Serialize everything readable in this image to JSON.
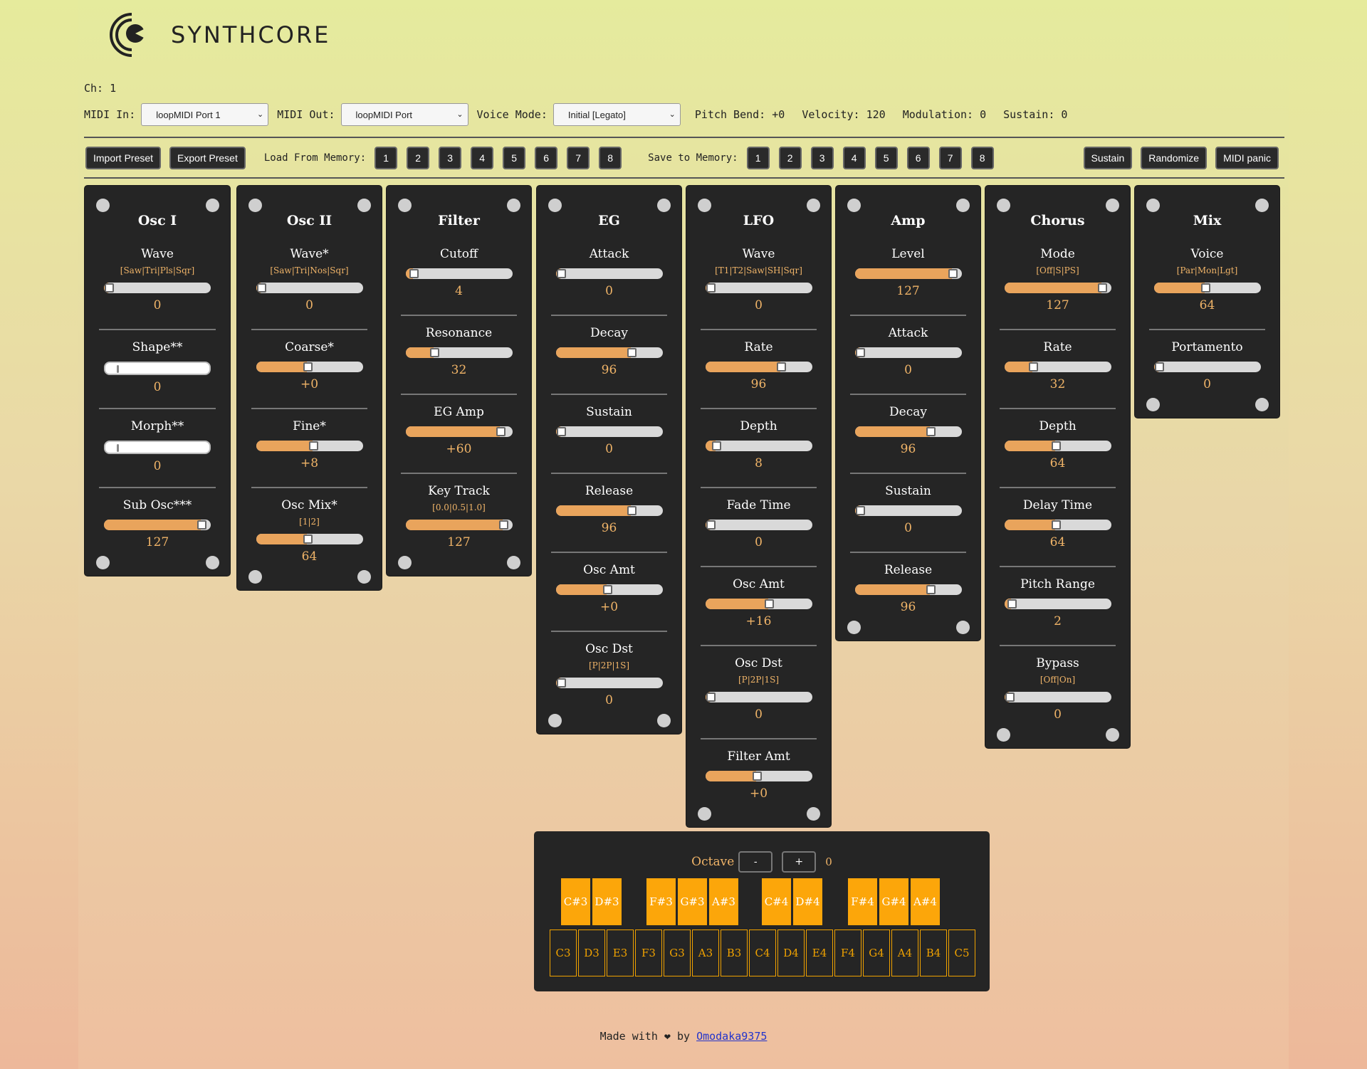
{
  "app": {
    "logo_text": "SYNTHCORE",
    "channel": "Ch: 1"
  },
  "midi": {
    "in_label": "MIDI In:",
    "in_value": "loopMIDI Port 1",
    "out_label": "MIDI Out:",
    "out_value": "loopMIDI Port",
    "voice_label": "Voice Mode:",
    "voice_value": "Initial [Legato]",
    "pitch_bend": "Pitch Bend: +0",
    "velocity": "Velocity: 120",
    "modulation": "Modulation: 0",
    "sustain": "Sustain: 0"
  },
  "toolbar": {
    "import": "Import Preset",
    "export": "Export Preset",
    "load_label": "Load From Memory:",
    "save_label": "Save to Memory:",
    "slots": [
      "1",
      "2",
      "3",
      "4",
      "5",
      "6",
      "7",
      "8"
    ],
    "sustain": "Sustain",
    "randomize": "Randomize",
    "panic": "MIDI panic"
  },
  "panels": [
    {
      "title": "Osc I",
      "params": [
        {
          "name": "Wave",
          "opts": "[Saw|Tri|Pls|Sqr]",
          "value": "0",
          "level": 0
        },
        {
          "name": "Shape**",
          "opts": "",
          "value": "0",
          "level": 0,
          "style": "white"
        },
        {
          "name": "Morph**",
          "opts": "",
          "value": "0",
          "level": 0,
          "style": "white"
        },
        {
          "name": "Sub Osc***",
          "opts": "",
          "value": "127",
          "level": 1
        }
      ]
    },
    {
      "title": "Osc II",
      "params": [
        {
          "name": "Wave*",
          "opts": "[Saw|Tri|Nos|Sqr]",
          "value": "0",
          "level": 0
        },
        {
          "name": "Coarse*",
          "opts": "",
          "value": "+0",
          "level": 0.5
        },
        {
          "name": "Fine*",
          "opts": "",
          "value": "+8",
          "level": 0.56
        },
        {
          "name": "Osc Mix*",
          "opts": "[1|2]",
          "value": "64",
          "level": 0.5
        }
      ]
    },
    {
      "title": "Filter",
      "params": [
        {
          "name": "Cutoff",
          "opts": "",
          "value": "4",
          "level": 0.03
        },
        {
          "name": "Resonance",
          "opts": "",
          "value": "32",
          "level": 0.25
        },
        {
          "name": "EG Amp",
          "opts": "",
          "value": "+60",
          "level": 0.97
        },
        {
          "name": "Key Track",
          "opts": "[0.0|0.5|1.0]",
          "value": "127",
          "level": 1
        }
      ]
    },
    {
      "title": "EG",
      "params": [
        {
          "name": "Attack",
          "opts": "",
          "value": "0",
          "level": 0
        },
        {
          "name": "Decay",
          "opts": "",
          "value": "96",
          "level": 0.76
        },
        {
          "name": "Sustain",
          "opts": "",
          "value": "0",
          "level": 0
        },
        {
          "name": "Release",
          "opts": "",
          "value": "96",
          "level": 0.76
        },
        {
          "name": "Osc Amt",
          "opts": "",
          "value": "+0",
          "level": 0.5
        },
        {
          "name": "Osc Dst",
          "opts": "[P|2P|1S]",
          "value": "0",
          "level": 0
        }
      ]
    },
    {
      "title": "LFO",
      "params": [
        {
          "name": "Wave",
          "opts": "[T1|T2|Saw|SH|Sqr]",
          "value": "0",
          "level": 0
        },
        {
          "name": "Rate",
          "opts": "",
          "value": "96",
          "level": 0.76
        },
        {
          "name": "Depth",
          "opts": "",
          "value": "8",
          "level": 0.06
        },
        {
          "name": "Fade Time",
          "opts": "",
          "value": "0",
          "level": 0
        },
        {
          "name": "Osc Amt",
          "opts": "",
          "value": "+16",
          "level": 0.63
        },
        {
          "name": "Osc Dst",
          "opts": "[P|2P|1S]",
          "value": "0",
          "level": 0
        },
        {
          "name": "Filter Amt",
          "opts": "",
          "value": "+0",
          "level": 0.5
        }
      ]
    },
    {
      "title": "Amp",
      "params": [
        {
          "name": "Level",
          "opts": "",
          "value": "127",
          "level": 1
        },
        {
          "name": "Attack",
          "opts": "",
          "value": "0",
          "level": 0
        },
        {
          "name": "Decay",
          "opts": "",
          "value": "96",
          "level": 0.76
        },
        {
          "name": "Sustain",
          "opts": "",
          "value": "0",
          "level": 0
        },
        {
          "name": "Release",
          "opts": "",
          "value": "96",
          "level": 0.76
        }
      ]
    },
    {
      "title": "Chorus",
      "params": [
        {
          "name": "Mode",
          "opts": "[Off|S|PS]",
          "value": "127",
          "level": 1
        },
        {
          "name": "Rate",
          "opts": "",
          "value": "32",
          "level": 0.25
        },
        {
          "name": "Depth",
          "opts": "",
          "value": "64",
          "level": 0.5
        },
        {
          "name": "Delay Time",
          "opts": "",
          "value": "64",
          "level": 0.5
        },
        {
          "name": "Pitch Range",
          "opts": "",
          "value": "2",
          "level": 0.02
        },
        {
          "name": "Bypass",
          "opts": "[Off|On]",
          "value": "0",
          "level": 0
        }
      ]
    },
    {
      "title": "Mix",
      "params": [
        {
          "name": "Voice",
          "opts": "[Par|Mon|Lgt]",
          "value": "64",
          "level": 0.5
        },
        {
          "name": "Portamento",
          "opts": "",
          "value": "0",
          "level": 0
        }
      ]
    }
  ],
  "keyboard": {
    "octave_label": "Octave",
    "minus": "-",
    "plus": "+",
    "octave_value": "0",
    "black_keys": [
      "C#3",
      "D#3",
      "F#3",
      "G#3",
      "A#3",
      "C#4",
      "D#4",
      "F#4",
      "G#4",
      "A#4"
    ],
    "white_keys": [
      "C3",
      "D3",
      "E3",
      "F3",
      "G3",
      "A3",
      "B3",
      "C4",
      "D4",
      "E4",
      "F4",
      "G4",
      "A4",
      "B4",
      "C5"
    ]
  },
  "footer": {
    "prefix": "Made with",
    "heart": "❤",
    "by": "by",
    "author": "Omodaka9375"
  },
  "colors": {
    "accent": "#e9a45c",
    "value_text": "#f0b468",
    "key_black": "#fca60a",
    "panel": "#252525"
  }
}
